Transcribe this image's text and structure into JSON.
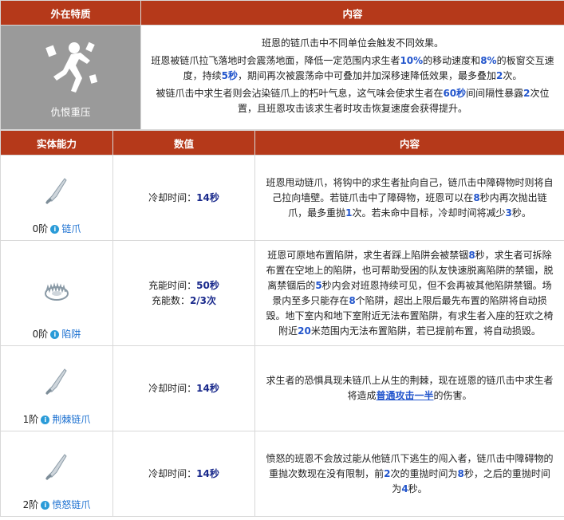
{
  "header": {
    "col1": "外在特质",
    "col2": "内容"
  },
  "trait": {
    "name": "仇恨重压",
    "icon": "running-figure-icon",
    "para1": "班恩的链爪击中不同单位会触发不同效果。",
    "para2": {
      "p1": "班恩被链爪拉飞落地时会震荡地面，降低一定范围内求生者",
      "v1": "10%",
      "p2": "的移动速度和",
      "v2": "8%",
      "p3": "的板窗交互速度，持续",
      "v3": "5秒",
      "p4": "，期间再次被震荡命中可叠加并加深移速降低效果，最多叠加",
      "v4": "2",
      "p5": "次。"
    },
    "para3": {
      "p1": "被链爪击中求生者则会沾染链爪上的朽叶气息，这气味会使求生者在",
      "v1": "60秒",
      "p2": "间间隔性暴露",
      "v2": "2",
      "p3": "次位置，且班恩攻击该求生者时攻击恢复速度会获得提升。"
    }
  },
  "abilities_header": {
    "col1": "实体能力",
    "col2": "数值",
    "col3": "内容"
  },
  "abilities": [
    {
      "tier": "0阶",
      "name": "链爪",
      "icon": "chain-claw-icon",
      "val_label1": "冷却时间：",
      "val1": "14秒",
      "desc": {
        "p1": "班恩甩动链爪，将钩中的求生者扯向自己，链爪击中障碍物时则将自己拉向墙壁。若链爪击中了障碍物，班恩可以在",
        "v1": "8",
        "p2": "秒内再次抛出链爪，最多重抛",
        "v2": "1",
        "p3": "次。若未命中目标，冷却时间将减少",
        "v3": "3",
        "p4": "秒。"
      }
    },
    {
      "tier": "0阶",
      "name": "陷阱",
      "icon": "bear-trap-icon",
      "val_label1": "充能时间：",
      "val1": "50秒",
      "val_label2": "充能数：",
      "val2": "2/3次",
      "desc": {
        "p1": "班恩可原地布置陷阱，求生者踩上陷阱会被禁锢",
        "v1": "8",
        "p2": "秒，求生者可拆除布置在空地上的陷阱，也可帮助受困的队友快速脱离陷阱的禁锢，脱离禁锢后的",
        "v2": "5",
        "p3": "秒内会对班恩持续可见，但不会再被其他陷阱禁锢。场景内至多只能存在",
        "v3": "8",
        "p4": "个陷阱，超出上限后最先布置的陷阱将自动损毁。地下室内和地下室附近无法布置陷阱，有求生者入座的狂欢之椅附近",
        "v4": "20",
        "p5": "米范围内无法布置陷阱，若已提前布置，将自动损毁。"
      }
    },
    {
      "tier": "1阶",
      "name": "荆棘链爪",
      "icon": "chain-claw-icon",
      "val_label1": "冷却时间：",
      "val1": "14秒",
      "desc": {
        "p1": "求生者的恐惧具现未链爪上从生的荆棘，现在班恩的链爪击中求生者将造成",
        "v1": "普通攻击一半",
        "p2": "的伤害。"
      }
    },
    {
      "tier": "2阶",
      "name": "愤怒链爪",
      "icon": "chain-claw-icon",
      "val_label1": "冷却时间：",
      "val1": "14秒",
      "desc": {
        "p1": "愤怒的班恩不会放过能从他链爪下逃生的闯入者，链爪击中障碍物的重抛次数现在没有限制，前",
        "v1": "2",
        "p2": "次的重抛时间为",
        "v2": "8",
        "p3": "秒，之后的重抛时间为",
        "v3": "4",
        "p4": "秒。"
      }
    }
  ],
  "colors": {
    "header": "#b5391a",
    "trait_bg": "#9a9a9a",
    "highlight": "#2255cc",
    "link": "#1a6fd0"
  }
}
